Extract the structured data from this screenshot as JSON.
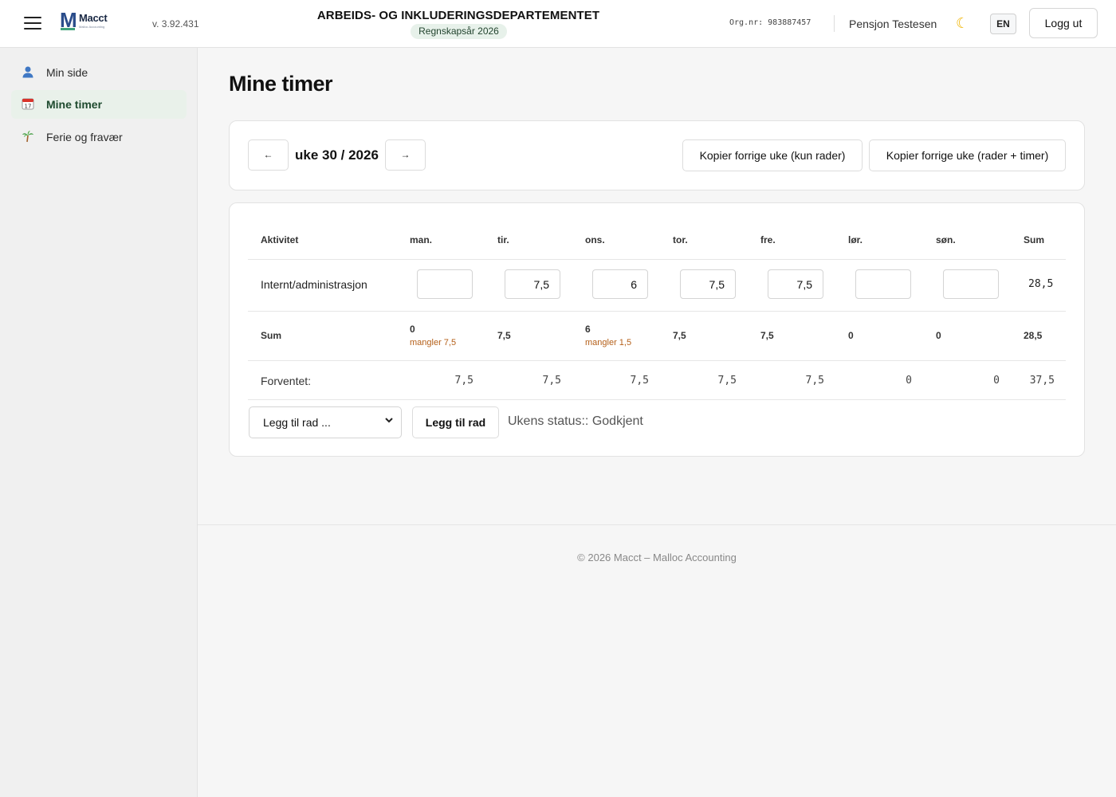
{
  "header": {
    "logo_name": "Macct",
    "logo_sub": "Malloc Accounting",
    "version": "v. 3.92.431",
    "org_title": "ARBEIDS- OG INKLUDERINGSDEPARTEMENTET",
    "fiscal_year": "Regnskapsår 2026",
    "org_nr": "Org.nr: 983887457",
    "user_name": "Pensjon Testesen",
    "theme_icon": "moon-icon",
    "lang_label": "EN",
    "logout_label": "Logg ut"
  },
  "sidebar": {
    "items": [
      {
        "label": "Min side",
        "icon": "user-icon",
        "active": false
      },
      {
        "label": "Mine timer",
        "icon": "calendar-icon",
        "active": true
      },
      {
        "label": "Ferie og fravær",
        "icon": "palm-tree-icon",
        "active": false
      }
    ]
  },
  "main": {
    "title": "Mine timer",
    "week": {
      "prev_label": "←",
      "label": "uke 30 / 2026",
      "next_label": "→",
      "copy_rows_label": "Kopier forrige uke (kun rader)",
      "copy_rows_hours_label": "Kopier forrige uke (rader + timer)"
    },
    "table": {
      "headers": [
        "Aktivitet",
        "man.",
        "tir.",
        "ons.",
        "tor.",
        "fre.",
        "lør.",
        "søn.",
        "Sum"
      ],
      "rows": [
        {
          "activity": "Internt/administrasjon",
          "hours": [
            "",
            "7,5",
            "6",
            "7,5",
            "7,5",
            "",
            ""
          ],
          "sum": "28,5"
        }
      ],
      "sum_row": {
        "label": "Sum",
        "values": [
          "0",
          "7,5",
          "6",
          "7,5",
          "7,5",
          "0",
          "0"
        ],
        "missing": [
          "mangler 7,5",
          "",
          "mangler 1,5",
          "",
          "",
          "",
          ""
        ],
        "total": "28,5"
      },
      "expected_row": {
        "label": "Forventet:",
        "values": [
          "7,5",
          "7,5",
          "7,5",
          "7,5",
          "7,5",
          "0",
          "0"
        ],
        "total": "37,5"
      }
    },
    "add_row": {
      "select_value": "Legg til rad ...",
      "button_label": "Legg til rad"
    },
    "week_status": "Ukens status:: Godkjent"
  },
  "footer": {
    "text": "© 2026 Macct – Malloc Accounting"
  },
  "colors": {
    "active_bg": "#e9f1ea",
    "missing": "#b5601a",
    "brand": "#2a4c8a"
  }
}
